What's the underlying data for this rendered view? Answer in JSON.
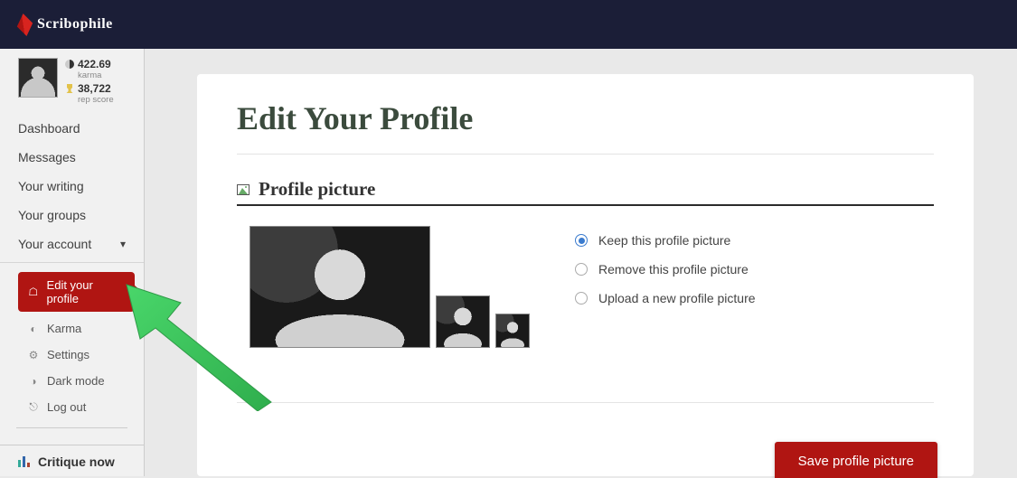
{
  "brand": {
    "name": "Scribophile"
  },
  "user_stats": {
    "karma_value": "422.69",
    "karma_label": "karma",
    "rep_value": "38,722",
    "rep_label": "rep score"
  },
  "sidebar": {
    "items": [
      {
        "label": "Dashboard"
      },
      {
        "label": "Messages"
      },
      {
        "label": "Your writing"
      },
      {
        "label": "Your groups"
      },
      {
        "label": "Your account"
      }
    ],
    "account_submenu": [
      {
        "label": "Edit your profile",
        "icon": "id-card-icon",
        "active": true
      },
      {
        "label": "Karma",
        "icon": "yin-yang-icon"
      },
      {
        "label": "Settings",
        "icon": "gear-icon"
      },
      {
        "label": "Dark mode",
        "icon": "toggle-icon"
      },
      {
        "label": "Log out",
        "icon": "logout-icon"
      }
    ],
    "critique_label": "Critique now"
  },
  "page": {
    "title": "Edit Your Profile",
    "section_title": "Profile picture",
    "options": [
      "Keep this profile picture",
      "Remove this profile picture",
      "Upload a new profile picture"
    ],
    "selected_option_index": 0,
    "save_button": "Save profile picture"
  }
}
